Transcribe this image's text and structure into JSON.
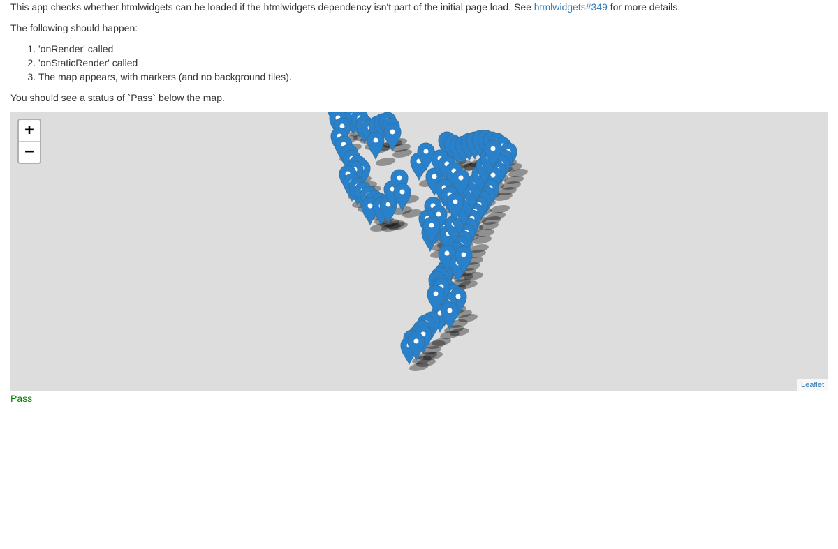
{
  "intro": {
    "text_before": "This app checks whether htmlwidgets can be loaded if the htmlwidgets dependency isn't part of the initial page load. See ",
    "link_text": "htmlwidgets#349",
    "text_after": " for more details."
  },
  "instructions": {
    "lead": "The following should happen:",
    "steps": [
      "'onRender' called",
      "'onStaticRender' called",
      "The map appears, with markers (and no background tiles)."
    ]
  },
  "status_note": "You should see a status of `Pass` below the map.",
  "map": {
    "zoom_in_label": "+",
    "zoom_out_label": "−",
    "attribution": "Leaflet",
    "background_color": "#dddddd",
    "marker_color": "#2a81cb",
    "marker_icon": "map-marker-icon"
  },
  "status": {
    "text": "Pass",
    "color": "#008000"
  }
}
